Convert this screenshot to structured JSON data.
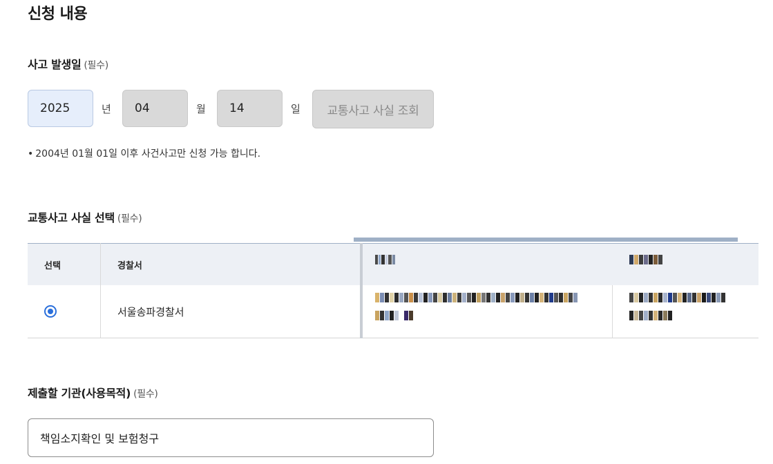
{
  "page": {
    "title": "신청 내용"
  },
  "accident_date": {
    "label": "사고 발생일",
    "required": "(필수)",
    "year": "2025",
    "year_unit": "년",
    "month": "04",
    "month_unit": "월",
    "day": "14",
    "day_unit": "일",
    "lookup_button": "교통사고 사실 조회",
    "hint": "2004년 01월 01일 이후 사건사고만 신청 가능 합니다."
  },
  "accident_select": {
    "label": "교통사고 사실 선택",
    "required": "(필수)",
    "columns": [
      "선택",
      "경찰서"
    ],
    "rows": [
      {
        "selected": true,
        "police_station": "서울송파경찰서"
      }
    ]
  },
  "submit_org": {
    "label": "제출할 기관(사용목적)",
    "required": "(필수)",
    "value": "책임소지확인 및 보험청구"
  },
  "colors": {
    "accent": "#2a6fdb",
    "year_bg": "#e6eefb",
    "disabled_bg": "#d9d9d9",
    "header_bg": "#edf0f5"
  }
}
